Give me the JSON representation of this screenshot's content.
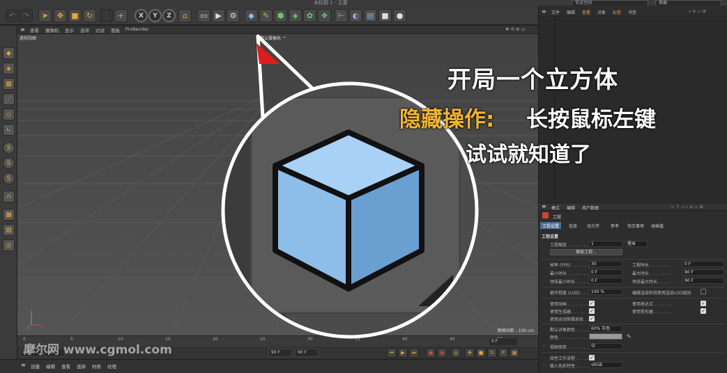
{
  "window": {
    "title": "未标题 1 - 主要",
    "layout_select": "节点空间",
    "layout_select2": "界面"
  },
  "viewport_menu": [
    "查看",
    "摄像机",
    "显示",
    "选项",
    "过滤",
    "面板",
    "ProRender"
  ],
  "viewport": {
    "label": "透视视图",
    "camera": "默认摄像机 ·°",
    "grid_info": "网格间距 : 100 cm"
  },
  "timeline": {
    "ticks": [
      "0",
      "5",
      "10",
      "15",
      "20",
      "25",
      "30",
      "35",
      "40",
      "45",
      "50"
    ],
    "current_frame": "0 F"
  },
  "transport": {
    "start": "0 F",
    "start2": "0 F",
    "end": "90 F",
    "end2": "90 F"
  },
  "bottom_menu": [
    "创建",
    "编辑",
    "查看",
    "选择",
    "材质",
    "纹理"
  ],
  "object_manager_menu": [
    "文件",
    "编辑",
    "查看",
    "对象",
    "标签",
    "书签"
  ],
  "attribute_manager": {
    "menu": [
      "模式",
      "编辑",
      "用户数据"
    ],
    "project_title": "工程",
    "tabs": [
      "工程设置",
      "信息",
      "动力学",
      "参考",
      "待办事项",
      "帧插值"
    ],
    "active_tab": "工程设置",
    "section_title": "工程设置",
    "scale_label": "工程缩放 . . . . . . . .",
    "scale_value": "1",
    "scale_unit": "厘米",
    "scale_button": "缩放工程...",
    "fps_label": "帧率 (FPS) . . . . . . .",
    "fps_value": "30",
    "project_time_label": "工程时长 . . . . . . . .",
    "project_time_value": "0 F",
    "min_time_label": "最小时长 . . . . . . . .",
    "min_time_value": "0 F",
    "max_time_label": "最大时长 . . . . . . . .",
    "max_time_value": "90 F",
    "preview_min_label": "预览最小时长 . . . . .",
    "preview_min_value": "0 F",
    "preview_max_label": "预览最大时长 . . . . .",
    "preview_max_value": "90 F",
    "lod_label": "细节程度 (LOD) . . . . .",
    "lod_value": "100 %",
    "render_lod_label": "编辑渲染检视使用渲染LOD级别",
    "use_animation_label": "使用动画 . . . . . . . .",
    "use_expression_label": "使用表达式 . . . . . . .",
    "use_generator_label": "使用生成器 . . . . . . .",
    "use_deformer_label": "使用变形器 . . . . . . .",
    "use_motion_label": "使用运动剪辑系统 . . .",
    "default_color_label": "默认对象颜色 . . . . .",
    "default_color_value": "60% 灰色",
    "color_label": "颜色 . . . . . . . . . . .",
    "view_clip_label": "视图修剪 . . . . . . . .",
    "view_clip_value": "中",
    "linear_workflow_label": "线性工作流程 . . . . .",
    "input_color_label": "输入色彩特性 . . . . .",
    "input_color_value": "sRGB"
  },
  "overlay": {
    "line1": "开局一个立方体",
    "line2_highlight": "隐藏操作:",
    "line2_rest": "长按鼠标左键",
    "line3": "试试就知道了",
    "watermark": "摩尔网 www.cgmol.com"
  },
  "colors": {
    "accent_orange": "#e6a33a",
    "highlight_text": "#f2b531",
    "cube_top": "#a9d0f5",
    "cube_left": "#8dbde9",
    "cube_right": "#6a9fd1",
    "active_tab": "#4b6c95"
  }
}
